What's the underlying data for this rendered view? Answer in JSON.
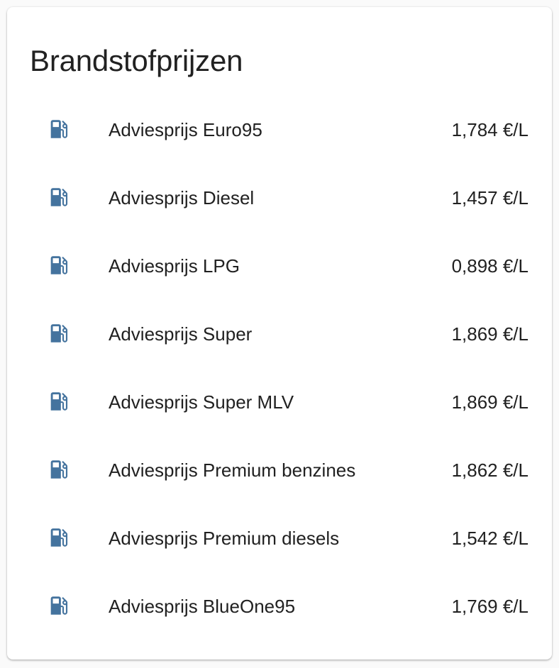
{
  "card": {
    "title": "Brandstofprijzen"
  },
  "colors": {
    "icon": "#44739e",
    "text": "#212121",
    "background": "#ffffff"
  },
  "entities": [
    {
      "icon": "gas-station-icon",
      "name": "Adviesprijs Euro95",
      "state": "1,784 €/L"
    },
    {
      "icon": "gas-station-icon",
      "name": "Adviesprijs Diesel",
      "state": "1,457 €/L"
    },
    {
      "icon": "gas-station-icon",
      "name": "Adviesprijs LPG",
      "state": "0,898 €/L"
    },
    {
      "icon": "gas-station-icon",
      "name": "Adviesprijs Super",
      "state": "1,869 €/L"
    },
    {
      "icon": "gas-station-icon",
      "name": "Adviesprijs Super MLV",
      "state": "1,869 €/L"
    },
    {
      "icon": "gas-station-icon",
      "name": "Adviesprijs Premium benzines",
      "state": "1,862 €/L"
    },
    {
      "icon": "gas-station-icon",
      "name": "Adviesprijs Premium diesels",
      "state": "1,542 €/L"
    },
    {
      "icon": "gas-station-icon",
      "name": "Adviesprijs BlueOne95",
      "state": "1,769 €/L"
    }
  ]
}
